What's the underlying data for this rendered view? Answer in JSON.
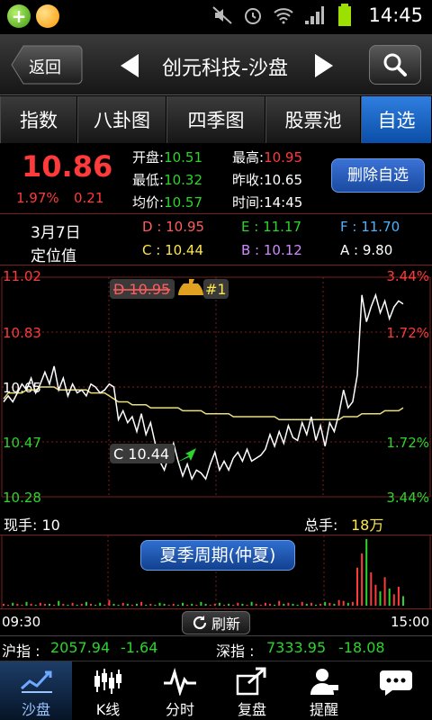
{
  "status_bar": {
    "time": "14:45"
  },
  "header": {
    "back_label": "返回",
    "title": "创元科技-沙盘"
  },
  "tabs": [
    {
      "label": "指数",
      "active": false
    },
    {
      "label": "八卦图",
      "active": false
    },
    {
      "label": "四季图",
      "active": false
    },
    {
      "label": "股票池",
      "active": false
    },
    {
      "label": "自选",
      "active": true
    }
  ],
  "quote": {
    "price": "10.86",
    "change_pct": "1.97%",
    "change": "0.21",
    "open_label": "开盘:",
    "open": "10.51",
    "high_label": "最高:",
    "high": "10.95",
    "low_label": "最低:",
    "low": "10.32",
    "prev_close_label": "昨收:",
    "prev_close": "10.65",
    "avg_label": "均价:",
    "avg": "10.57",
    "time_label": "时间:",
    "time": "14:45",
    "delete_button": "删除自选"
  },
  "positions": {
    "date": "3月7日",
    "title": "定位值",
    "D": "D : 10.95",
    "E": "E : 11.17",
    "F": "F : 11.70",
    "C": "C : 10.44",
    "B": "B : 10.12",
    "A": "A : 9.80"
  },
  "chart_data": {
    "type": "line",
    "y_ticks": [
      "11.02",
      "10.83",
      "10.65",
      "10.47",
      "10.28"
    ],
    "pct_ticks": [
      "3.44%",
      "1.72%",
      "",
      "1.72%",
      "3.44%"
    ],
    "ylim": [
      10.28,
      11.02
    ],
    "markers": {
      "D": {
        "label": "D 10.95",
        "badge": "#1"
      },
      "C": {
        "label": "C 10.44"
      }
    },
    "series": [
      {
        "values": [
          10.6,
          10.62,
          10.6,
          10.63,
          10.66,
          10.64,
          10.68,
          10.63,
          10.66,
          10.7,
          10.66,
          10.72,
          10.64,
          10.68,
          10.62,
          10.66,
          10.63,
          10.64,
          10.62,
          10.66,
          10.65,
          10.63,
          10.64,
          10.66,
          10.65,
          10.54,
          10.57,
          10.53,
          10.55,
          10.5,
          10.56,
          10.49,
          10.53,
          10.46,
          10.4,
          10.37,
          10.42,
          10.46,
          10.4,
          10.35,
          10.39,
          10.34,
          10.37,
          10.36,
          10.34,
          10.39,
          10.43,
          10.37,
          10.4,
          10.37,
          10.41,
          10.43,
          10.4,
          10.44,
          10.4,
          10.41,
          10.42,
          10.44,
          10.49,
          10.45,
          10.5,
          10.46,
          10.52,
          10.48,
          10.47,
          10.53,
          10.49,
          10.55,
          10.47,
          10.52,
          10.45,
          10.53,
          10.5,
          10.56,
          10.64,
          10.58,
          10.6,
          10.69,
          10.96,
          10.87,
          10.92,
          10.96,
          10.9,
          10.94,
          10.88,
          10.92,
          10.94,
          10.93
        ]
      },
      {
        "values": [
          10.61,
          10.63,
          10.63,
          10.63,
          10.63,
          10.64,
          10.64,
          10.64,
          10.65,
          10.65,
          10.65,
          10.65,
          10.64,
          10.64,
          10.64,
          10.64,
          10.64,
          10.64,
          10.64,
          10.63,
          10.63,
          10.63,
          10.63,
          10.62,
          10.61,
          10.6,
          10.6,
          10.6,
          10.59,
          10.59,
          10.59,
          10.59,
          10.58,
          10.58,
          10.58,
          10.58,
          10.58,
          10.58,
          10.58,
          10.57,
          10.57,
          10.57,
          10.57,
          10.57,
          10.56,
          10.56,
          10.56,
          10.56,
          10.56,
          10.56,
          10.55,
          10.55,
          10.55,
          10.55,
          10.55,
          10.55,
          10.55,
          10.55,
          10.55,
          10.55,
          10.54,
          10.54,
          10.54,
          10.54,
          10.54,
          10.54,
          10.54,
          10.54,
          10.54,
          10.54,
          10.54,
          10.54,
          10.54,
          10.54,
          10.55,
          10.55,
          10.55,
          10.55,
          10.56,
          10.56,
          10.56,
          10.56,
          10.56,
          10.57,
          10.57,
          10.57,
          10.57,
          10.58
        ]
      }
    ]
  },
  "trade_stats": {
    "current_label": "现手: 10",
    "total_label": "总手: ",
    "total_value": "18万"
  },
  "season_button": "夏季周期(仲夏)",
  "volume_data": [
    2,
    1,
    3,
    2,
    1,
    4,
    2,
    1,
    3,
    2,
    2,
    1,
    5,
    2,
    1,
    3,
    1,
    2,
    4,
    2,
    1,
    3,
    1,
    6,
    2,
    1,
    3,
    2,
    1,
    2,
    4,
    1,
    2,
    1,
    3,
    2,
    1,
    2,
    1,
    3,
    1,
    2,
    1,
    4,
    2,
    1,
    2,
    3,
    1,
    2,
    1,
    3,
    2,
    1,
    4,
    2,
    1,
    3,
    2,
    1,
    5,
    2,
    3,
    2,
    1,
    4,
    2,
    3,
    1,
    2,
    4,
    3,
    2,
    6,
    5,
    3,
    4,
    40,
    55,
    70,
    35,
    22,
    15,
    30,
    18,
    12,
    20,
    10
  ],
  "time_axis": {
    "start": "09:30",
    "end": "15:00",
    "refresh": "刷新"
  },
  "index_bar": {
    "sh_label": "沪指 : ",
    "sh_value": "2057.94",
    "sh_change": "-1.64",
    "sz_label": "深指 : ",
    "sz_value": "7333.95",
    "sz_change": "-18.08"
  },
  "bottom_nav": [
    {
      "label": "沙盘",
      "icon": "sandbox-chart-icon",
      "active": true
    },
    {
      "label": "K线",
      "icon": "kline-icon",
      "active": false
    },
    {
      "label": "分时",
      "icon": "timeshare-icon",
      "active": false
    },
    {
      "label": "复盘",
      "icon": "replay-icon",
      "active": false
    },
    {
      "label": "提醒",
      "icon": "alert-user-icon",
      "active": false
    },
    {
      "label": "",
      "icon": "chat-icon",
      "active": false
    }
  ],
  "colors": {
    "up": "#ff3a3a",
    "down": "#2bd52b",
    "price_line": "#ffffff",
    "avg_line": "#e8e07a",
    "D": "#ff5d5d",
    "E": "#2bd52b",
    "F": "#4ab3ff",
    "C": "#ffe74a",
    "B": "#d08aff",
    "A": "#ffffff"
  }
}
